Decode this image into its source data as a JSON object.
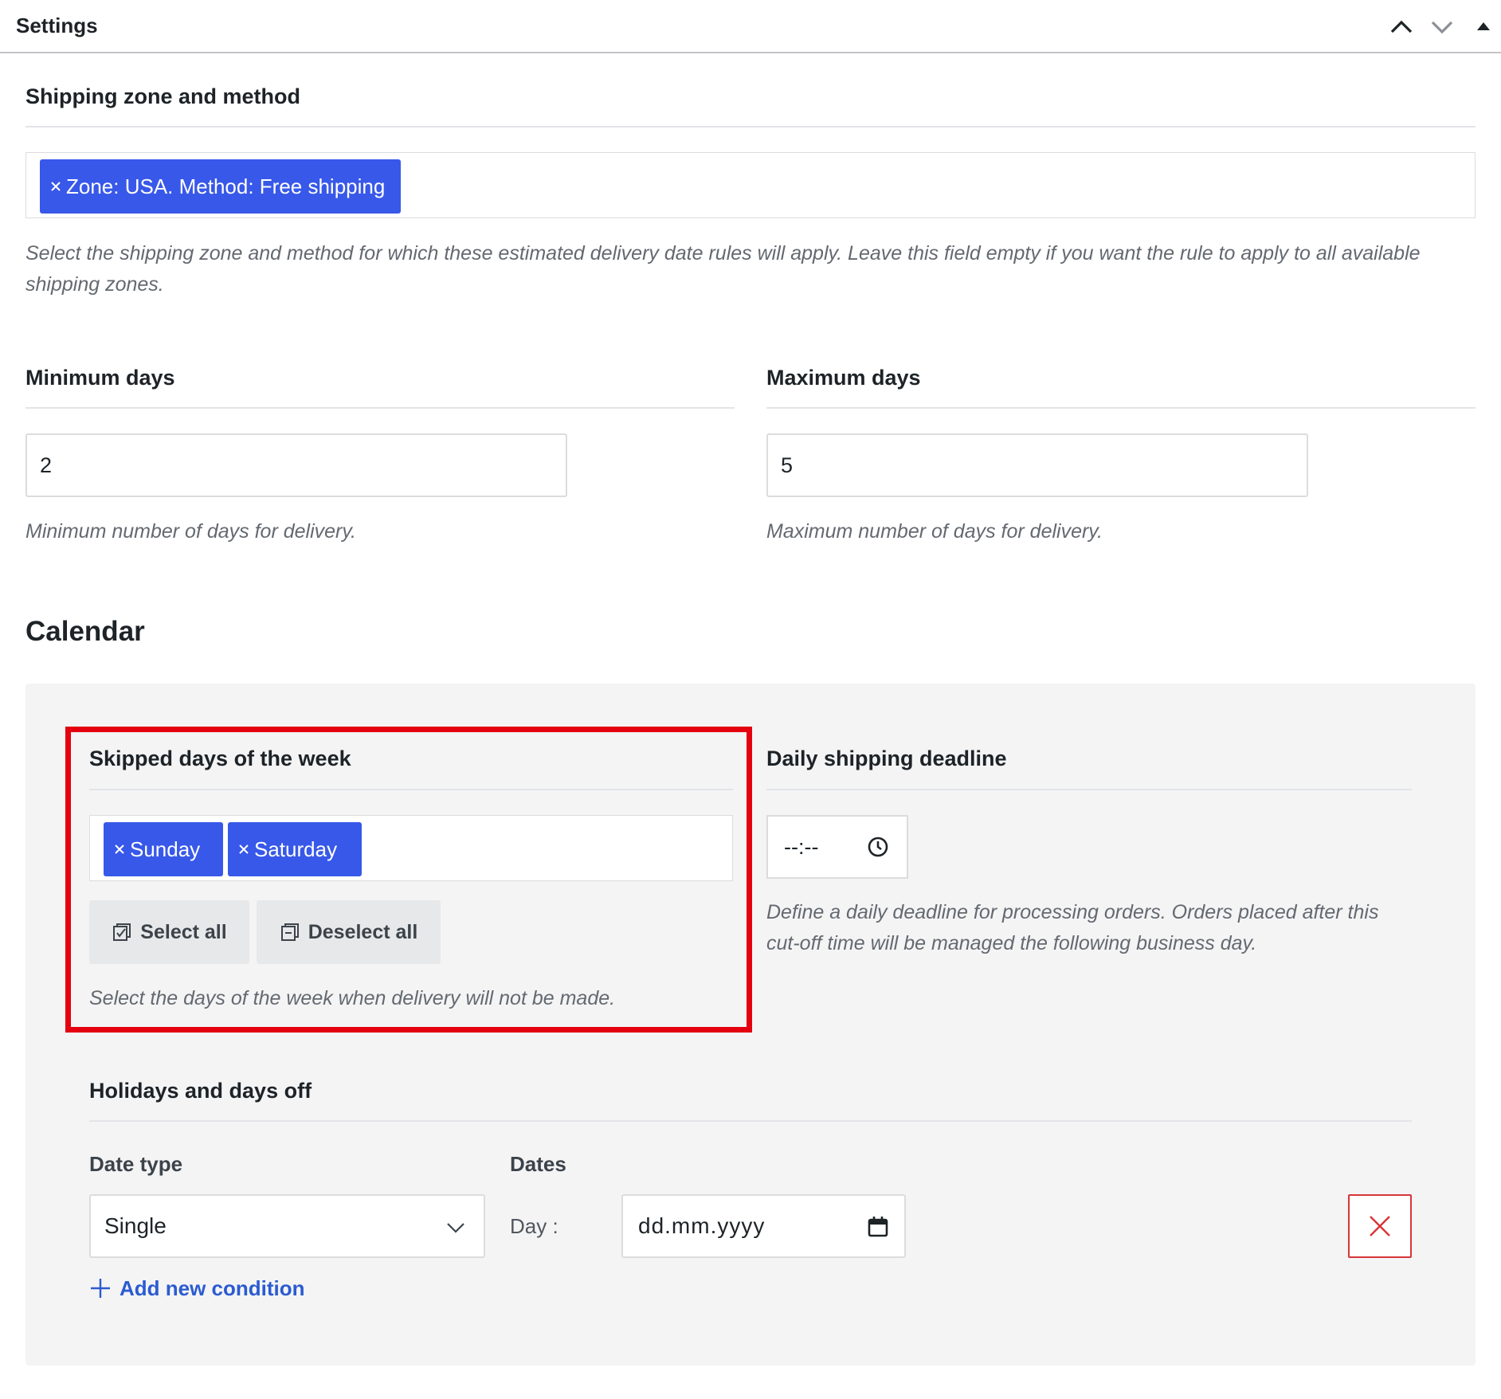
{
  "header": {
    "title": "Settings",
    "move_up_icon": "chevron-up-icon",
    "move_down_icon": "chevron-down-icon",
    "toggle_icon": "triangle-up-icon"
  },
  "shipping": {
    "title": "Shipping zone and method",
    "tags": [
      "Zone: USA. Method: Free shipping"
    ],
    "description": "Select the shipping zone and method for which these estimated delivery date rules will apply. Leave this field empty if you want the rule to apply to all available shipping zones."
  },
  "min_days": {
    "title": "Minimum days",
    "value": "2",
    "description": "Minimum number of days for delivery."
  },
  "max_days": {
    "title": "Maximum days",
    "value": "5",
    "description": "Maximum number of days for delivery."
  },
  "calendar": {
    "title": "Calendar",
    "skipped": {
      "title": "Skipped days of the week",
      "tags": [
        "Sunday",
        "Saturday"
      ],
      "select_all_label": "Select all",
      "deselect_all_label": "Deselect all",
      "description": "Select the days of the week when delivery will not be made."
    },
    "deadline": {
      "title": "Daily shipping deadline",
      "time_value": "--:--",
      "description": "Define a daily deadline for processing orders. Orders placed after this cut-off time will be managed the following business day."
    },
    "holidays": {
      "title": "Holidays and days off",
      "date_type_label": "Date type",
      "dates_label": "Dates",
      "date_type_value": "Single",
      "day_label": "Day :",
      "date_placeholder": "dd.mm.yyyy",
      "add_condition_label": "Add new condition"
    }
  },
  "colors": {
    "accent": "#3858e9",
    "highlight": "#e4000f",
    "danger": "#d63638",
    "link": "#2b5bd0"
  }
}
